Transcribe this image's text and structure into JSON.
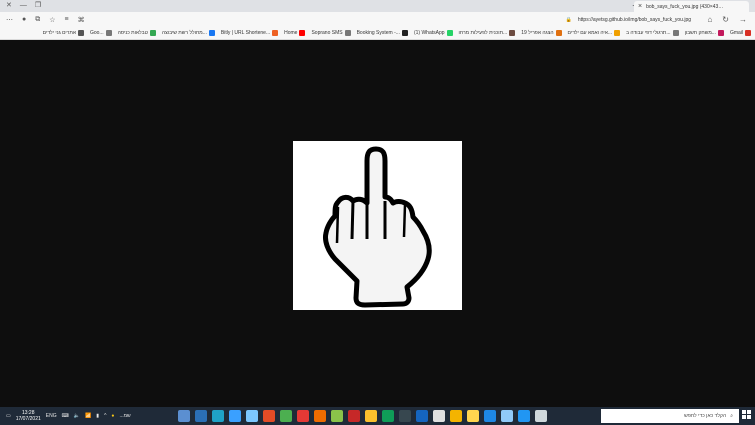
{
  "tab": {
    "title": "bob_says_fuck_you.jpg (430×43…",
    "close": "×",
    "new_tab": "+"
  },
  "window": {
    "minimize": "—"
  },
  "address": {
    "url": "https://ayetsg.github.io/img/bob_says_fuck_you.jpg"
  },
  "bookmarks": [
    {
      "label": "Gmail",
      "color": "#d93025"
    },
    {
      "label": "משחק חשבון...",
      "color": "#c2185b"
    },
    {
      "label": "תרגולי דפי עבודה ב...",
      "color": "#777777"
    },
    {
      "label": "איה ואמא עם ילדים...",
      "color": "#f0a000"
    },
    {
      "label": "הצגה אפריל 19",
      "color": "#e07010"
    },
    {
      "label": "תוכנית לפעילות מרחו...",
      "color": "#6d4c41"
    },
    {
      "label": "(1) WhatsApp",
      "color": "#25d366"
    },
    {
      "label": "Booking System -...",
      "color": "#222222"
    },
    {
      "label": "Soprano SMS",
      "color": "#777777"
    },
    {
      "label": "Home",
      "color": "#ff0000"
    },
    {
      "label": "Bitly | URL Shortene...",
      "color": "#ee6123"
    },
    {
      "label": "מחולל רשת שיבוצה...",
      "color": "#1877f2"
    },
    {
      "label": "טבלאות כניסה",
      "color": "#34a853"
    },
    {
      "label": "Goo...",
      "color": "#777777"
    },
    {
      "label": "אתרים גני ילדים",
      "color": "#555555"
    }
  ],
  "taskbar": {
    "time": "13:28",
    "date": "17/07/2021",
    "lang": "ENG",
    "weather": "...שמ",
    "search_placeholder": "הקלד כאן כדי לחפש"
  },
  "colors": {
    "viewer_bg": "#0e0e0e",
    "taskbar_bg": "#1f2a38"
  }
}
